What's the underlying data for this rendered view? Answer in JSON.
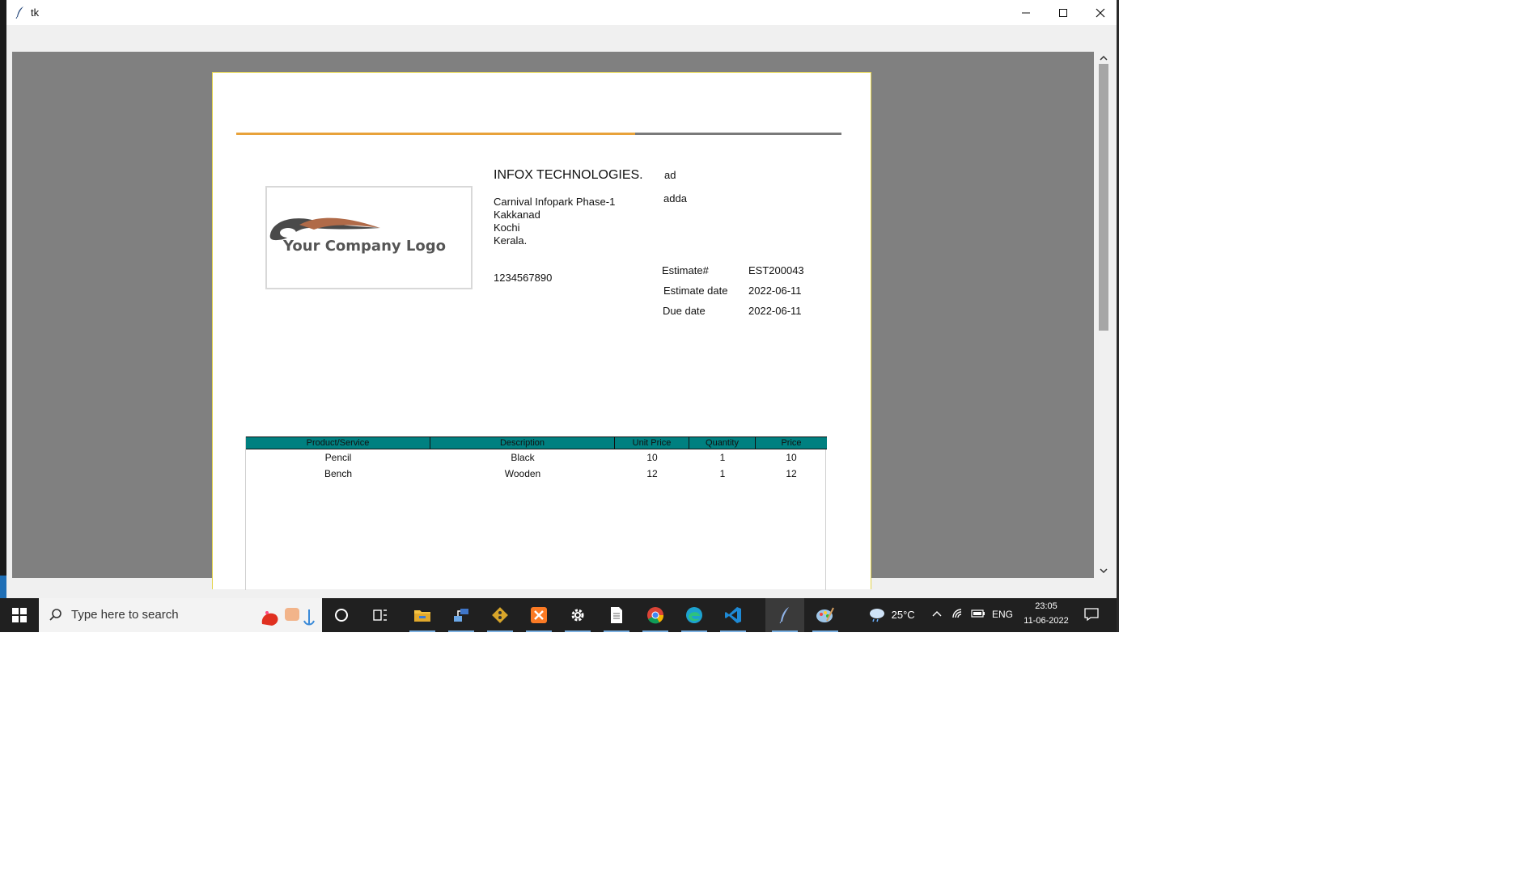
{
  "window": {
    "title": "tk",
    "controls": {
      "minimize": "minimize-icon",
      "maximize": "maximize-icon",
      "close": "close-icon"
    }
  },
  "logo_text": "Your Company Logo",
  "company": {
    "name": "INFOX TECHNOLOGIES.",
    "address": [
      "Carnival Infopark Phase-1",
      "Kakkanad",
      "Kochi",
      "Kerala."
    ],
    "phone": "1234567890"
  },
  "client": {
    "line1": "ad",
    "line2": "adda"
  },
  "estimate": [
    {
      "label": "Estimate#",
      "value": "EST200043"
    },
    {
      "label": "Estimate date",
      "value": "2022-06-11"
    },
    {
      "label": "Due date",
      "value": "2022-06-11"
    }
  ],
  "table": {
    "headers": [
      "Product/Service",
      "Description",
      "Unit Price",
      "Quantity",
      "Price"
    ],
    "rows": [
      [
        "Pencil",
        "Black",
        "10",
        "1",
        "10"
      ],
      [
        "Bench",
        "Wooden",
        "12",
        "1",
        "12"
      ]
    ]
  },
  "colors": {
    "header_teal": "#008080",
    "rule_orange": "#e8a23a",
    "rule_gray": "#7a7a7a",
    "canvas_gray": "#808080"
  },
  "taskbar": {
    "search_placeholder": "Type here to search",
    "apps": [
      "cortana-icon",
      "task-view-icon",
      "file-explorer-icon",
      "network-app-icon",
      "git-icon",
      "xampp-icon",
      "settings-icon",
      "document-icon",
      "chrome-icon",
      "edge-icon",
      "vscode-icon",
      "python-tk-icon",
      "paint-icon"
    ],
    "weather": "25°C",
    "language": "ENG",
    "time": "23:05",
    "date": "11-06-2022"
  }
}
